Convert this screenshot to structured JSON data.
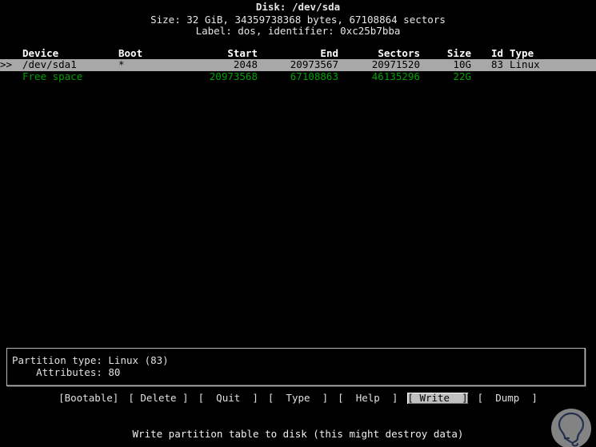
{
  "app": {
    "name": "cfdisk",
    "screen_bg": "#000000",
    "fg": "#d8d8d8",
    "accent_green": "#00a000",
    "selection_bg": "#a8a8a8"
  },
  "header": {
    "disk_line": "Disk: /dev/sda",
    "size_line": "Size: 32 GiB, 34359738368 bytes, 67108864 sectors",
    "label_line": "Label: dos, identifier: 0xc25b7bba"
  },
  "table": {
    "columns": [
      "Device",
      "Boot",
      "Start",
      "End",
      "Sectors",
      "Size",
      "Id",
      "Type"
    ],
    "rows": [
      {
        "marker": ">>",
        "device": "/dev/sda1",
        "boot": "*",
        "start": "2048",
        "end": "20973567",
        "sectors": "20971520",
        "size": "10G",
        "id": "83",
        "type": "Linux",
        "selected": true,
        "free": false
      },
      {
        "marker": "",
        "device": "Free space",
        "boot": "",
        "start": "20973568",
        "end": "67108863",
        "sectors": "46135296",
        "size": "22G",
        "id": "",
        "type": "",
        "selected": false,
        "free": true
      }
    ]
  },
  "info": {
    "partition_type": "Partition type: Linux (83)",
    "attributes": "    Attributes: 80"
  },
  "menu": {
    "items": [
      {
        "label": "[Bootable]",
        "active": false
      },
      {
        "label": "[ Delete ]",
        "active": false
      },
      {
        "label": "[  Quit  ]",
        "active": false
      },
      {
        "label": "[  Type  ]",
        "active": false
      },
      {
        "label": "[  Help  ]",
        "active": false
      },
      {
        "label": "[ Write  ]",
        "active": true
      },
      {
        "label": "[  Dump  ]",
        "active": false
      }
    ]
  },
  "status": {
    "text": "Write partition table to disk (this might destroy data)"
  },
  "watermark": {
    "icon": "lightbulb-icon",
    "circle_color": "#9a9a9a",
    "glyph_color": "#2b3a5c"
  }
}
